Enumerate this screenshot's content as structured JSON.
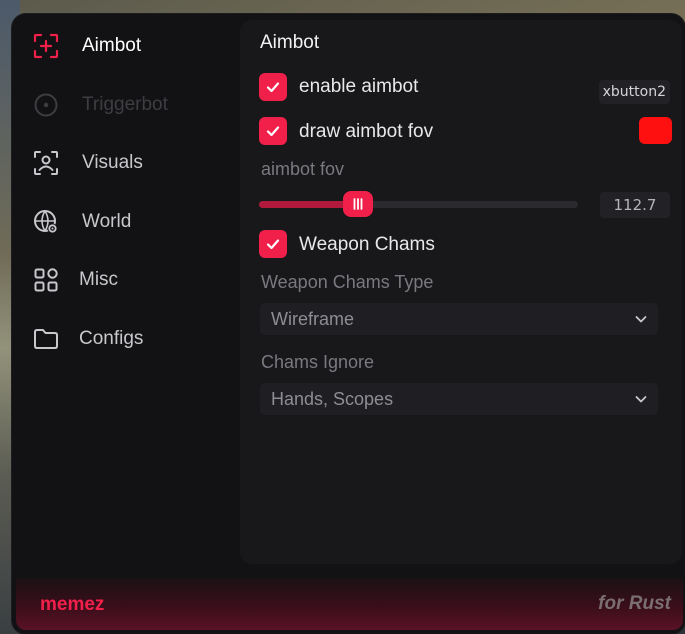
{
  "sidebar": {
    "items": [
      {
        "label": "Aimbot",
        "icon": "crosshair-plus-icon",
        "state": "active"
      },
      {
        "label": "Triggerbot",
        "icon": "target-circle-icon",
        "state": "disabled"
      },
      {
        "label": "Visuals",
        "icon": "user-scan-icon",
        "state": "normal"
      },
      {
        "label": "World",
        "icon": "globe-gear-icon",
        "state": "normal"
      },
      {
        "label": "Misc",
        "icon": "grid-icon",
        "state": "normal"
      },
      {
        "label": "Configs",
        "icon": "folder-icon",
        "state": "normal"
      }
    ]
  },
  "panel": {
    "title": "Aimbot",
    "enable_aimbot": {
      "label": "enable aimbot",
      "checked": true,
      "keybind": "xbutton2"
    },
    "draw_fov": {
      "label": "draw aimbot fov",
      "checked": true,
      "color": "#ff1010"
    },
    "fov_slider": {
      "label": "aimbot fov",
      "value": "112.7",
      "fraction": 0.31
    },
    "weapon_chams": {
      "label": "Weapon Chams",
      "checked": true
    },
    "chams_type": {
      "label": "Weapon Chams Type",
      "value": "Wireframe"
    },
    "chams_ignore": {
      "label": "Chams Ignore",
      "value": "Hands, Scopes"
    }
  },
  "footer": {
    "brand": "memez",
    "tagline": "for Rust"
  },
  "colors": {
    "accent": "#f0204a",
    "background": "#121113",
    "panel": "#18171a"
  }
}
